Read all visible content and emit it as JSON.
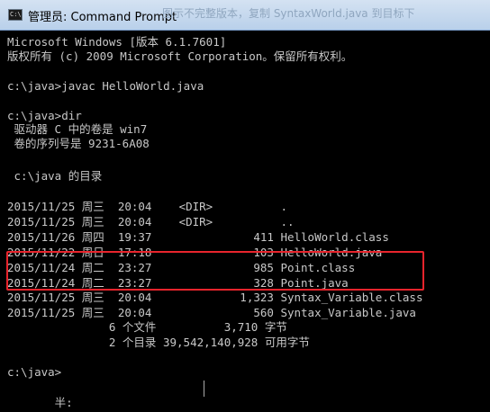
{
  "window": {
    "title": "管理员: Command Prompt",
    "background_ghost": "图示不完整版本，复制 SyntaxWorld.java 到目标下"
  },
  "console": {
    "lines": [
      "Microsoft Windows [版本 6.1.7601]",
      "版权所有 (c) 2009 Microsoft Corporation。保留所有权利。",
      "",
      "c:\\java>javac HelloWorld.java",
      "",
      "c:\\java>dir",
      " 驱动器 C 中的卷是 win7",
      " 卷的序列号是 9231-6A08",
      "",
      " c:\\java 的目录",
      "",
      "2015/11/25 周三  20:04    <DIR>          .",
      "2015/11/25 周三  20:04    <DIR>          ..",
      "2015/11/26 周四  19:37               411 HelloWorld.class",
      "2015/11/22 周日  17:18               103 HelloWorld.java",
      "2015/11/24 周二  23:27               985 Point.class",
      "2015/11/24 周二  23:27               328 Point.java",
      "2015/11/25 周三  20:04             1,323 Syntax_Variable.class",
      "2015/11/25 周三  20:04               560 Syntax_Variable.java",
      "               6 个文件          3,710 字节",
      "               2 个目录 39,542,140,928 可用字节",
      "",
      "c:\\java>",
      "",
      "       半:"
    ]
  },
  "colors": {
    "console_bg": "#000000",
    "console_text": "#c8c8c8",
    "highlight_border": "#e8242c",
    "titlebar": "#c9dbef"
  },
  "icons": {
    "window_icon": "command-prompt-icon"
  }
}
